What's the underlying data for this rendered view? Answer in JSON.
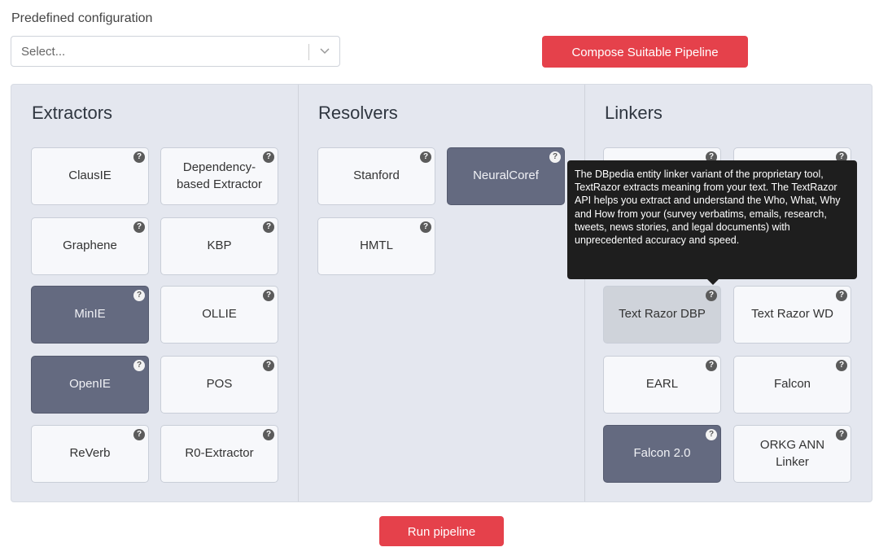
{
  "config": {
    "label": "Predefined configuration",
    "placeholder": "Select..."
  },
  "buttons": {
    "compose": "Compose Suitable Pipeline",
    "run": "Run pipeline"
  },
  "help_glyph": "?",
  "colors": {
    "accent": "#e5414b",
    "panel": "#e4e7ef",
    "selected": "#646a80",
    "tooltip": "#1e1e1e"
  },
  "sections": {
    "extractors": {
      "title": "Extractors",
      "tools": [
        {
          "label": "ClausIE",
          "selected": false
        },
        {
          "label": "Dependency-based Extractor",
          "selected": false
        },
        {
          "label": "Graphene",
          "selected": false
        },
        {
          "label": "KBP",
          "selected": false
        },
        {
          "label": "MinIE",
          "selected": true
        },
        {
          "label": "OLLIE",
          "selected": false
        },
        {
          "label": "OpenIE",
          "selected": true
        },
        {
          "label": "POS",
          "selected": false
        },
        {
          "label": "ReVerb",
          "selected": false
        },
        {
          "label": "R0-Extractor",
          "selected": false
        }
      ]
    },
    "resolvers": {
      "title": "Resolvers",
      "tools": [
        {
          "label": "Stanford",
          "selected": false
        },
        {
          "label": "NeuralCoref",
          "selected": true
        },
        {
          "label": "HMTL",
          "selected": false
        }
      ]
    },
    "linkers": {
      "title": "Linkers",
      "tools": [
        {
          "label": "",
          "selected": false
        },
        {
          "label": "",
          "selected": false
        },
        {
          "label": "",
          "selected": false
        },
        {
          "label": "",
          "selected": false
        },
        {
          "label": "Text Razor DBP",
          "selected": false
        },
        {
          "label": "Text Razor WD",
          "selected": false
        },
        {
          "label": "EARL",
          "selected": false
        },
        {
          "label": "Falcon",
          "selected": false
        },
        {
          "label": "Falcon 2.0",
          "selected": true
        },
        {
          "label": "ORKG ANN Linker",
          "selected": false
        }
      ]
    }
  },
  "tooltip": {
    "text": "The DBpedia entity linker variant of the proprietary tool, TextRazor extracts meaning from your text. The TextRazor API helps you extract and understand the Who, What, Why and How from your (survey verbatims, emails, research, tweets, news stories, and legal documents) with unprecedented accuracy and speed."
  }
}
